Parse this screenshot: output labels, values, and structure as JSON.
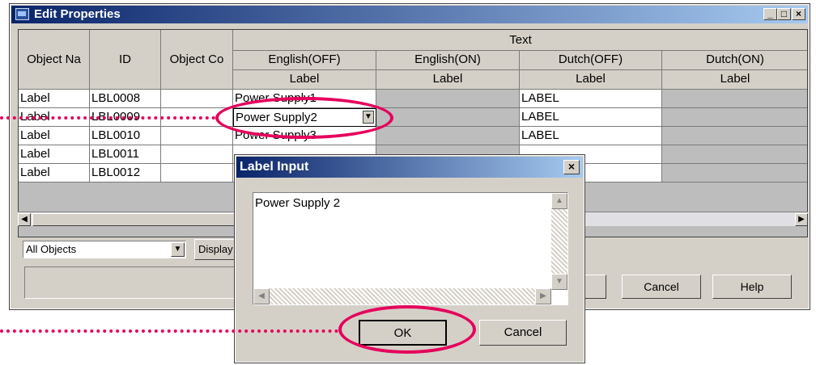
{
  "window": {
    "title": "Edit Properties"
  },
  "caption_buttons": {
    "minimize": "_",
    "maximize": "□",
    "close": "×"
  },
  "grid": {
    "group_header": "Text",
    "columns": [
      "Object Na",
      "ID",
      "Object Co"
    ],
    "lang_columns": [
      "English(OFF)",
      "English(ON)",
      "Dutch(OFF)",
      "Dutch(ON)"
    ],
    "lang_subheaders": [
      "Label",
      "Label",
      "Label",
      "Label"
    ],
    "rows": [
      {
        "name": "Label",
        "id": "LBL0008",
        "text": "Power Supply1",
        "dutch_off": "LABEL"
      },
      {
        "name": "Label",
        "id": "LBL0009",
        "text": "Power Supply2",
        "dutch_off": "LABEL"
      },
      {
        "name": "Label",
        "id": "LBL0010",
        "text": "Power Supply3",
        "dutch_off": "LABEL"
      },
      {
        "name": "Label",
        "id": "LBL0011",
        "text": "",
        "dutch_off": ""
      },
      {
        "name": "Label",
        "id": "LBL0012",
        "text": "",
        "dutch_off": ""
      }
    ]
  },
  "filter": {
    "selected": "All Objects"
  },
  "buttons": {
    "display": "Display",
    "cancel": "Cancel",
    "help": "Help"
  },
  "dialog": {
    "title": "Label Input",
    "text_value": "Power Supply 2",
    "ok": "OK",
    "cancel": "Cancel"
  },
  "colors": {
    "highlight": "#e5005b",
    "title_start": "#0a246a",
    "title_end": "#a6caf0"
  }
}
